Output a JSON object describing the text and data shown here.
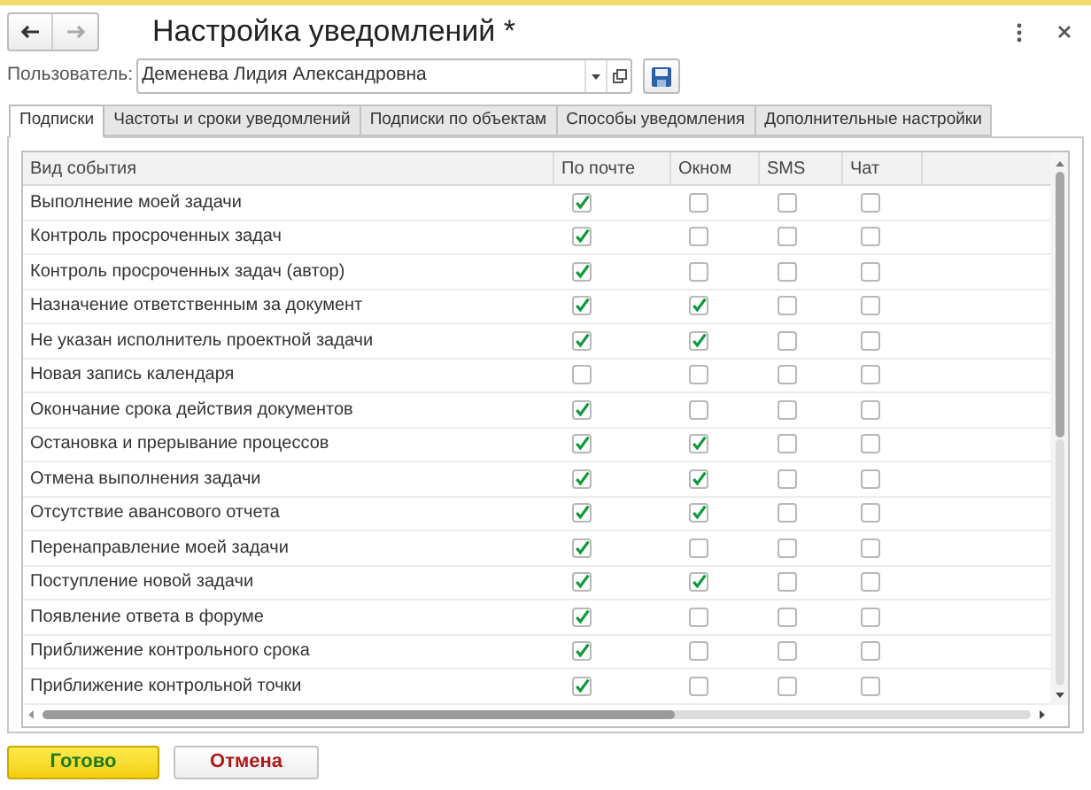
{
  "window": {
    "title": "Настройка уведомлений *"
  },
  "user": {
    "label": "Пользователь:",
    "value": "Деменева Лидия Александровна"
  },
  "tabs": [
    {
      "label": "Подписки",
      "selected": true
    },
    {
      "label": "Частоты и сроки уведомлений",
      "selected": false
    },
    {
      "label": "Подписки по объектам",
      "selected": false
    },
    {
      "label": "Способы уведомления",
      "selected": false
    },
    {
      "label": "Дополнительные настройки",
      "selected": false
    }
  ],
  "table": {
    "columns": [
      "Вид события",
      "По почте",
      "Окном",
      "SMS",
      "Чат"
    ],
    "rows": [
      {
        "event": "Выполнение моей задачи",
        "checks": [
          true,
          false,
          false,
          false
        ]
      },
      {
        "event": "Контроль просроченных задач",
        "checks": [
          true,
          false,
          false,
          false
        ]
      },
      {
        "event": "Контроль просроченных задач (автор)",
        "checks": [
          true,
          false,
          false,
          false
        ]
      },
      {
        "event": "Назначение ответственным за документ",
        "checks": [
          true,
          true,
          false,
          false
        ]
      },
      {
        "event": "Не указан исполнитель проектной задачи",
        "checks": [
          true,
          true,
          false,
          false
        ]
      },
      {
        "event": "Новая запись календаря",
        "checks": [
          false,
          false,
          false,
          false
        ]
      },
      {
        "event": "Окончание срока действия документов",
        "checks": [
          true,
          false,
          false,
          false
        ]
      },
      {
        "event": "Остановка и прерывание процессов",
        "checks": [
          true,
          true,
          false,
          false
        ]
      },
      {
        "event": "Отмена выполнения задачи",
        "checks": [
          true,
          true,
          false,
          false
        ]
      },
      {
        "event": "Отсутствие авансового отчета",
        "checks": [
          true,
          true,
          false,
          false
        ]
      },
      {
        "event": "Перенаправление моей задачи",
        "checks": [
          true,
          false,
          false,
          false
        ]
      },
      {
        "event": "Поступление новой задачи",
        "checks": [
          true,
          true,
          false,
          false
        ]
      },
      {
        "event": "Появление ответа в форуме",
        "checks": [
          true,
          false,
          false,
          false
        ]
      },
      {
        "event": "Приближение контрольного срока",
        "checks": [
          true,
          false,
          false,
          false
        ]
      },
      {
        "event": "Приближение контрольной точки",
        "checks": [
          true,
          false,
          false,
          false
        ]
      }
    ]
  },
  "buttons": [
    {
      "label": "Готово",
      "kind": "primary"
    },
    {
      "label": "Отмена",
      "kind": "cancel"
    }
  ]
}
